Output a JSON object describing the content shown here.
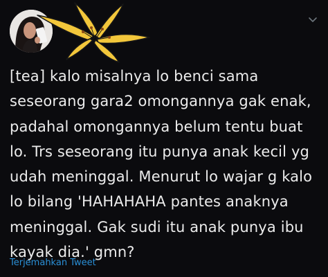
{
  "header": {
    "avatar_icon": "profile-photo",
    "overlay_icon": "yellow-lily-flower",
    "menu_icon": "chevron-down-icon"
  },
  "tweet": {
    "lines": [
      "[tea] kalo misalnya lo benci sama",
      "seseorang gara2 omongannya gak enak,",
      "padahal omongannya belum tentu buat",
      "lo. Trs seseorang itu punya anak kecil yg",
      "udah meninggal. Menurut lo wajar g kalo",
      "lo bilang 'HAHAHAHA pantes anaknya",
      "meninggal. Gak sudi itu anak punya ibu",
      "kayak dia.' gmn?"
    ]
  },
  "actions": {
    "translate_label": "Terjemahkan Tweet"
  },
  "colors": {
    "background": "#0b0b0e",
    "text": "#ececec",
    "link": "#2a8fd6",
    "flower": "#f3c73b"
  }
}
